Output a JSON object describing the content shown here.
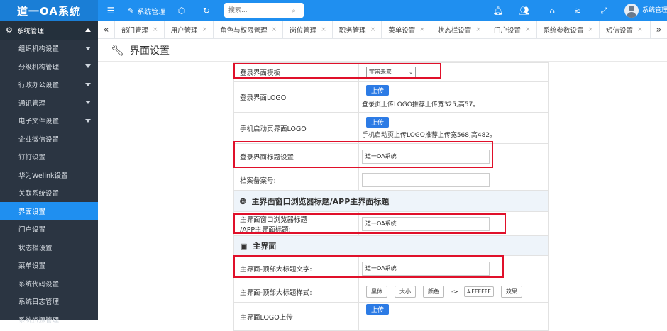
{
  "app": {
    "title": "道一OA系统"
  },
  "topbar": {
    "module_label": "系统管理",
    "search_placeholder": "搜索...",
    "user_name": "系统管理"
  },
  "sidebar": {
    "section": "系统管理",
    "items": [
      {
        "label": "组织机构设置",
        "has_caret": true
      },
      {
        "label": "分级机构管理",
        "has_caret": true
      },
      {
        "label": "行政办公设置",
        "has_caret": true
      },
      {
        "label": "通讯管理",
        "has_caret": true
      },
      {
        "label": "电子文件设置",
        "has_caret": true
      },
      {
        "label": "企业微信设置"
      },
      {
        "label": "钉钉设置"
      },
      {
        "label": "华为Welink设置"
      },
      {
        "label": "关联系统设置"
      },
      {
        "label": "界面设置",
        "active": true
      },
      {
        "label": "门户设置"
      },
      {
        "label": "状态栏设置"
      },
      {
        "label": "菜单设置"
      },
      {
        "label": "系统代码设置"
      },
      {
        "label": "系统日志管理"
      },
      {
        "label": "系统资源管理"
      }
    ]
  },
  "tabs": [
    "部门管理",
    "用户管理",
    "角色与权限管理",
    "岗位管理",
    "职务管理",
    "菜单设置",
    "状态栏设置",
    "门户设置",
    "系统参数设置",
    "短信设置"
  ],
  "page": {
    "title": "界面设置"
  },
  "form": {
    "login_template_label": "登录界面模板",
    "login_template_value": "宇宙未来",
    "login_logo_label": "登录界面LOGO",
    "upload_label": "上传",
    "login_logo_hint": "登录页上传LOGO推荐上传宽325,高57。",
    "mobile_logo_label": "手机启动页界面LOGO",
    "mobile_logo_hint": "手机启动页上传LOGO推荐上传宽568,高482。",
    "login_title_label": "登录界面标题设置",
    "login_title_value": "道一OA系统",
    "icp_label": "档案备案号:",
    "section_browser": "主界面窗口浏览器标题/APP主界面标题",
    "browser_title_label_1": "主界面窗口浏览器标题",
    "browser_title_label_2": "/APP主界面标题:",
    "browser_title_value": "道一OA系统",
    "section_main": "主界面",
    "main_title_label": "主界面-顶部大标题文字:",
    "main_title_value": "道一OA系统",
    "main_style_label": "主界面-顶部大标题样式:",
    "style_font": "黑体",
    "style_size": "大小",
    "style_color": "颜色",
    "style_arrow": "->",
    "style_hex": "#FFFFFF",
    "style_effect": "效果",
    "main_logo_label": "主界面LOGO上传"
  }
}
